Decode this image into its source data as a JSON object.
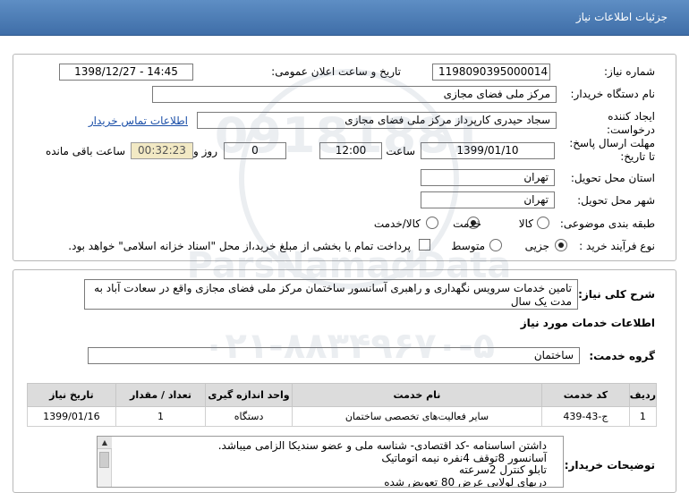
{
  "header": {
    "title": "جزئیات اطلاعات نیاز"
  },
  "form": {
    "need_number_label": "شماره نیاز:",
    "need_number": "1198090395000014",
    "announce_label": "تاریخ و ساعت اعلان عمومی:",
    "announce_value": "1398/12/27 - 14:45",
    "buyer_org_label": "نام دستگاه خریدار:",
    "buyer_org": "مرکز ملی فضای مجازی",
    "creator_label_1": "ایجاد کننده",
    "creator_label_2": "درخواست:",
    "creator": "سجاد حیدری کارپرداز مرکز ملی فضای مجازی",
    "contact_link": "اطلاعات تماس خریدار",
    "deadline_label_1": "مهلت ارسال پاسخ:",
    "deadline_label_2": "تا تاریخ:",
    "deadline_date": "1399/01/10",
    "time_label": "ساعت",
    "deadline_time": "12:00",
    "days_value": "0",
    "days_label": "روز و",
    "remaining_time": "00:32:23",
    "remaining_label": "ساعت باقی مانده",
    "province_label": "استان محل تحویل:",
    "province": "تهران",
    "city_label": "شهر محل تحویل:",
    "city": "تهران",
    "category_label": "طبقه بندی موضوعی:",
    "category_options": [
      "کالا",
      "خدمت",
      "کالا/خدمت"
    ],
    "process_label": "نوع فرآیند خرید :",
    "process_options": [
      "جزیی",
      "متوسط"
    ],
    "payment_note": "پرداخت تمام یا بخشی از مبلغ خرید،از محل \"اسناد خزانه اسلامی\" خواهد بود."
  },
  "summary": {
    "label": "شرح کلی نیاز:",
    "text": "تامین خدمات سرویس نگهداری و راهبری آسانسور ساختمان مرکز ملی فضای مجازی واقع در سعادت آباد به مدت یک سال",
    "services_title": "اطلاعات خدمات مورد نیاز",
    "service_group_label": "گروه خدمت:",
    "service_group": "ساختمان",
    "table_headers": [
      "ردیف",
      "کد خدمت",
      "نام خدمت",
      "واحد اندازه گیری",
      "تعداد / مقدار",
      "تاریخ نیاز"
    ],
    "table_rows": [
      {
        "row": "1",
        "code": "ج-43-439",
        "name": "سایر فعالیت‌های تخصصی ساختمان",
        "unit": "دستگاه",
        "qty": "1",
        "date": "1399/01/16"
      }
    ],
    "buyer_notes_label": "توضیحات خریدار:",
    "buyer_notes_lines": [
      "داشتن اساسنامه -کد اقتصادی- شناسه ملی و عضو سندیکا الزامی میباشد.",
      "آسانسور 8توقف 4نفره نیمه اتوماتیک",
      "تابلو کنترل 2سرعته",
      "دربهای لولایی عرض 80 تعویض شده"
    ]
  },
  "watermark": {
    "number": "09181881",
    "brand": "ParsNamadData",
    "phone": "۰۲۱-۸۸۳۴۹۶۷۰-۵"
  },
  "colors": {
    "header": "#4a7ab6",
    "timer_bg": "#f2e9c4",
    "link": "#1b4fa8"
  }
}
